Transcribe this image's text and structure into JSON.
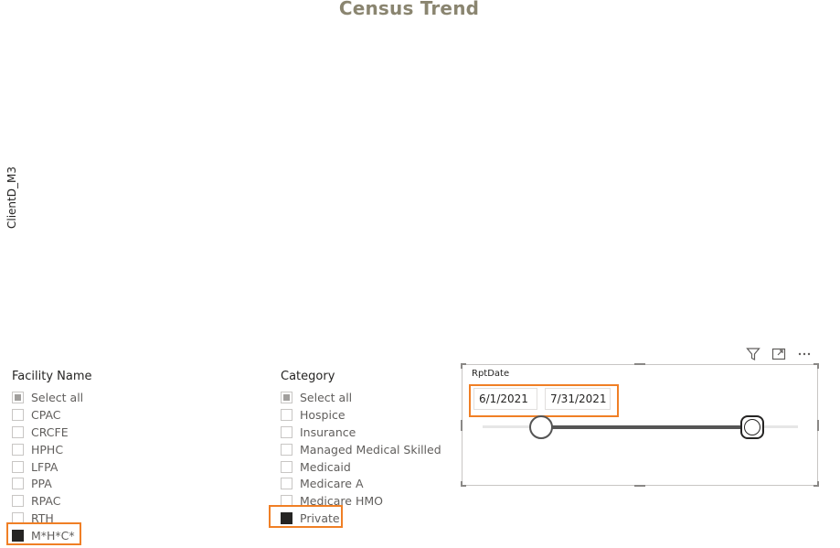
{
  "chart": {
    "title": "Census Trend",
    "y_axis_label": "ClientD_M3"
  },
  "facility_slicer": {
    "header": "Facility Name",
    "items": [
      {
        "label": "Select all",
        "state": "partial"
      },
      {
        "label": "CPAC",
        "state": "unchecked"
      },
      {
        "label": "CRCFE",
        "state": "unchecked"
      },
      {
        "label": "HPHC",
        "state": "unchecked"
      },
      {
        "label": "LFPA",
        "state": "unchecked"
      },
      {
        "label": "PPA",
        "state": "unchecked"
      },
      {
        "label": "RPAC",
        "state": "unchecked"
      },
      {
        "label": "RTH",
        "state": "unchecked"
      },
      {
        "label": "M*H*C*",
        "state": "checked"
      }
    ]
  },
  "category_slicer": {
    "header": "Category",
    "items": [
      {
        "label": "Select all",
        "state": "partial"
      },
      {
        "label": "Hospice",
        "state": "unchecked"
      },
      {
        "label": "Insurance",
        "state": "unchecked"
      },
      {
        "label": "Managed Medical Skilled",
        "state": "unchecked"
      },
      {
        "label": "Medicaid",
        "state": "unchecked"
      },
      {
        "label": "Medicare A",
        "state": "unchecked"
      },
      {
        "label": "Medicare HMO",
        "state": "unchecked"
      },
      {
        "label": "Private",
        "state": "checked"
      }
    ]
  },
  "date_slicer": {
    "title": "RptDate",
    "start_date": "6/1/2021",
    "end_date": "7/31/2021",
    "range_start_fraction": 0.185,
    "range_end_fraction": 0.855
  },
  "visual_header": {
    "icons": [
      "filter-icon",
      "focus-mode-icon",
      "more-options-icon"
    ]
  },
  "colors": {
    "highlight": "#f07f25",
    "title": "#8a8570",
    "checked": "#252423"
  }
}
